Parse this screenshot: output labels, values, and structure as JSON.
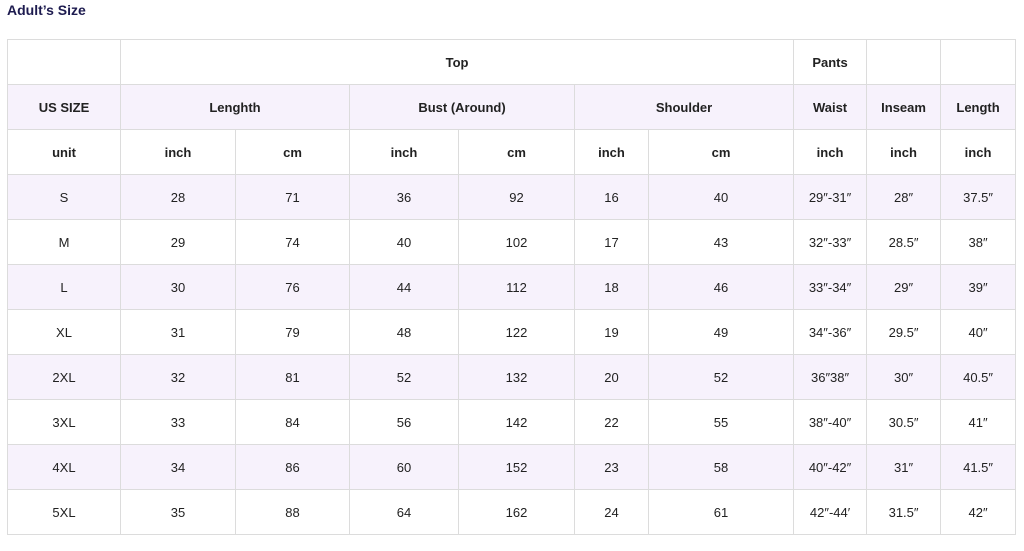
{
  "title": "Adult’s Size",
  "header_row1": {
    "top": "Top",
    "pants": "Pants"
  },
  "header_row2": [
    "US SIZE",
    "Lenghth",
    "Bust (Around)",
    "Shoulder",
    "Waist",
    "Inseam",
    "Length"
  ],
  "unit_row": [
    "unit",
    "inch",
    "cm",
    "inch",
    "cm",
    "inch",
    "cm",
    "inch",
    "inch",
    "inch"
  ],
  "rows": [
    [
      "S",
      "28",
      "71",
      "36",
      "92",
      "16",
      "40",
      "29″-31″",
      "28″",
      "37.5″"
    ],
    [
      "M",
      "29",
      "74",
      "40",
      "102",
      "17",
      "43",
      "32″-33″",
      "28.5″",
      "38″"
    ],
    [
      "L",
      "30",
      "76",
      "44",
      "112",
      "18",
      "46",
      "33″-34″",
      "29″",
      "39″"
    ],
    [
      "XL",
      "31",
      "79",
      "48",
      "122",
      "19",
      "49",
      "34″-36″",
      "29.5″",
      "40″"
    ],
    [
      "2XL",
      "32",
      "81",
      "52",
      "132",
      "20",
      "52",
      "36″38″",
      "30″",
      "40.5″"
    ],
    [
      "3XL",
      "33",
      "84",
      "56",
      "142",
      "22",
      "55",
      "38″-40″",
      "30.5″",
      "41″"
    ],
    [
      "4XL",
      "34",
      "86",
      "60",
      "152",
      "23",
      "58",
      "40″-42″",
      "31″",
      "41.5″"
    ],
    [
      "5XL",
      "35",
      "88",
      "64",
      "162",
      "24",
      "61",
      "42″-44′",
      "31.5″",
      "42″"
    ]
  ],
  "colors": {
    "title": "#1d1b4f",
    "row_alt_bg": "#f7f2fc",
    "border": "#dcdcdc"
  }
}
